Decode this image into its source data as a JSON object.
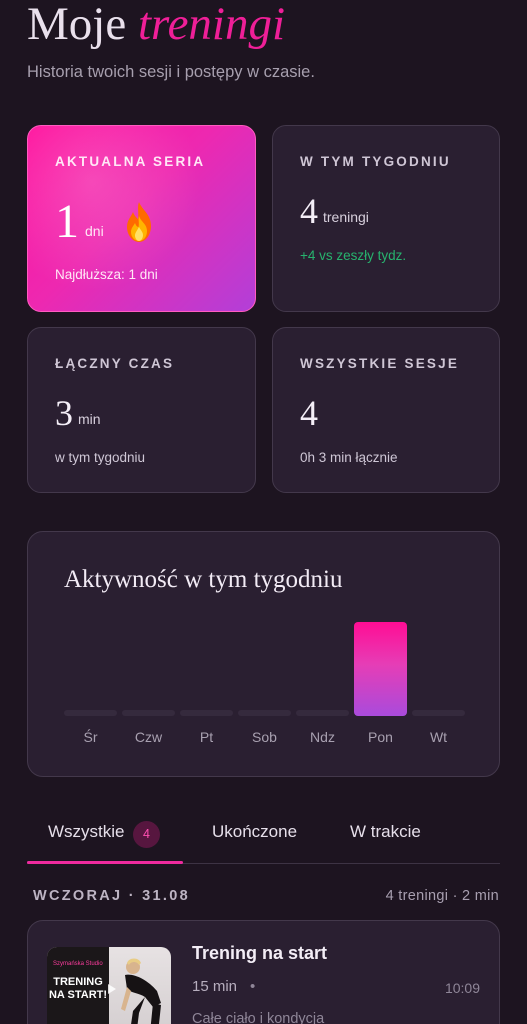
{
  "header": {
    "title_plain": "Moje",
    "title_accent": "treningi",
    "subtitle": "Historia twoich sesji i postępy w czasie."
  },
  "stats": {
    "streak": {
      "label": "AKTUALNA SERIA",
      "value": "1",
      "unit": "dni",
      "sub": "Najdłuższa: 1 dni",
      "icon": "flame-icon"
    },
    "week": {
      "label": "W TYM TYGODNIU",
      "value": "4",
      "unit": "treningi",
      "delta": "+4 vs zeszły tydz."
    },
    "total_time": {
      "label": "ŁĄCZNY CZAS",
      "value": "3",
      "unit": "min",
      "sub": "w tym tygodniu"
    },
    "all_sessions": {
      "label": "WSZYSTKIE SESJE",
      "value": "4",
      "sub": "0h 3 min łącznie"
    }
  },
  "activity": {
    "title": "Aktywność w tym tygodniu"
  },
  "chart_data": {
    "type": "bar",
    "title": "Aktywność w tym tygodniu",
    "categories": [
      "Śr",
      "Czw",
      "Pt",
      "Sob",
      "Ndz",
      "Pon",
      "Wt"
    ],
    "values": [
      0,
      0,
      0,
      0,
      0,
      3,
      0
    ],
    "xlabel": "",
    "ylabel": "",
    "grid": false
  },
  "tabs": [
    {
      "label": "Wszystkie",
      "badge": "4",
      "active": true
    },
    {
      "label": "Ukończone"
    },
    {
      "label": "W trakcie"
    }
  ],
  "history": {
    "day_label": "WCZORAJ · 31.08",
    "day_summary": "4 treningi · 2 min",
    "sessions": [
      {
        "title": "Trening na start",
        "duration": "15 min",
        "separator": "•",
        "time": "10:09",
        "description": "Całe ciało i kondycja",
        "thumb_brand": "Szymańska Studio",
        "thumb_text": "TRENING NA START!"
      }
    ]
  },
  "colors": {
    "accent": "#ef1f98",
    "background": "#1d1420",
    "card": "#2a1f31",
    "positive": "#27b36e"
  }
}
